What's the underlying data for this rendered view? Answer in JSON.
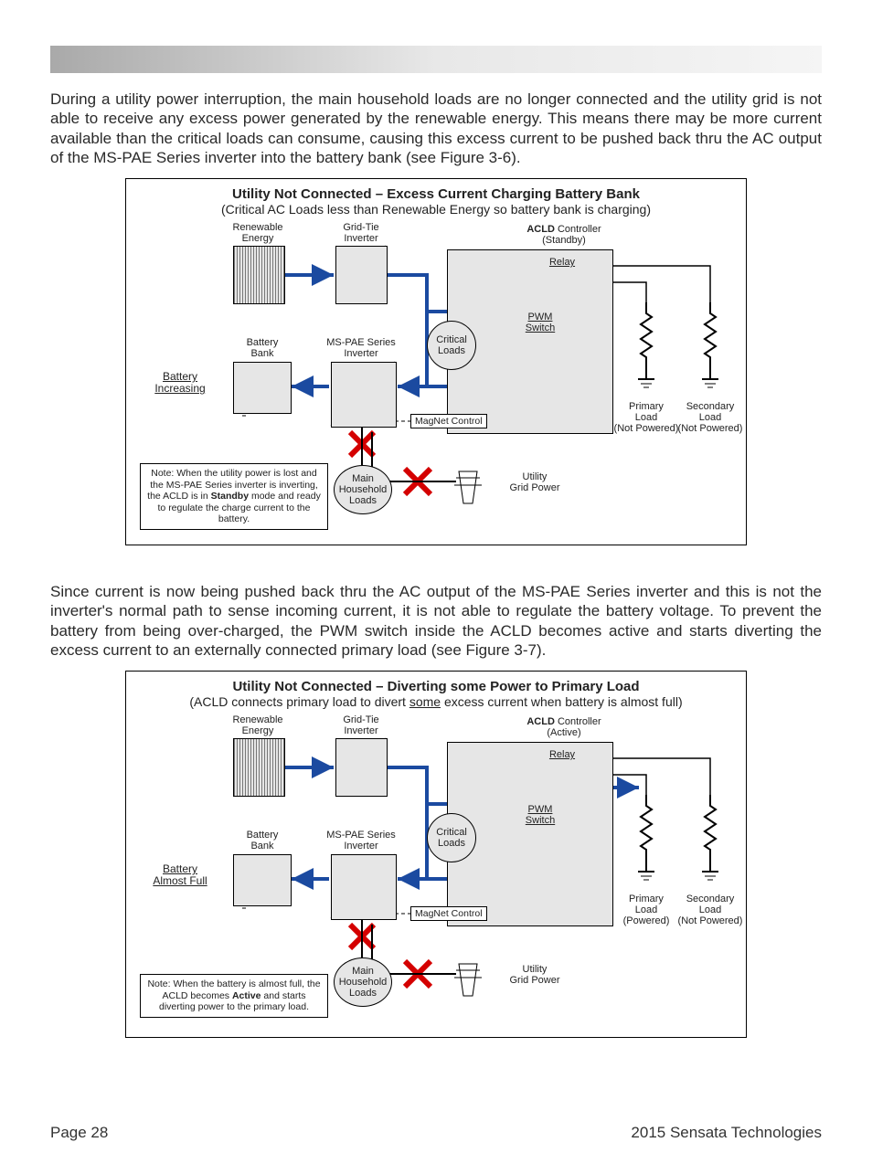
{
  "para1": "During a utility power interruption, the main household loads are no longer connected and the utility grid is not able to receive any excess power generated by the renewable energy. This means there may be more current available than the critical loads can consume, causing this excess current to be pushed back thru the AC output of the MS-PAE Series inverter into the battery bank (see Figure 3-6).",
  "para2": "Since current is now being pushed back thru the AC output of the MS-PAE Series inverter and this is not the inverter's normal path to sense incoming current, it is not able to regulate the battery voltage. To prevent the battery from being over-charged, the PWM switch inside the ACLD becomes active and starts diverting the excess current to an externally connected primary load (see Figure 3-7).",
  "fig1": {
    "title": "Utility Not Connected – Excess Current Charging Battery Bank",
    "subtitle": "(Critical AC Loads less than Renewable Energy so battery bank is charging)",
    "labels": {
      "renewable": "Renewable\nEnergy",
      "gridtie": "Grid-Tie\nInverter",
      "acld_bold": "ACLD",
      "acld_rest": " Controller",
      "acld_mode": "(Standby)",
      "relay": "Relay",
      "pwm": "PWM\nSwitch",
      "critical": "Critical\nLoads",
      "battery_bank": "Battery\nBank",
      "inverter": "MS-PAE Series\nInverter",
      "batt_state": "Battery\nIncreasing",
      "magnet": "MagNet Control",
      "main_loads": "Main\nHousehold\nLoads",
      "utility": "Utility\nGrid Power",
      "primary": "Primary\nLoad\n(Not Powered)",
      "secondary": "Secondary\nLoad\n(Not Powered)"
    },
    "note_pre": "Note: When the utility power is lost and the MS-PAE Series inverter is inverting, the ACLD is in ",
    "note_bold": "Standby",
    "note_post": " mode and ready to regulate the charge current to the battery."
  },
  "fig2": {
    "title": "Utility Not Connected – Diverting some Power to Primary Load",
    "subtitle_pre": "(ACLD connects primary load to divert ",
    "subtitle_u": "some",
    "subtitle_post": " excess current when battery is almost full)",
    "labels": {
      "renewable": "Renewable\nEnergy",
      "gridtie": "Grid-Tie\nInverter",
      "acld_bold": "ACLD",
      "acld_rest": " Controller",
      "acld_mode": "(Active)",
      "relay": "Relay",
      "pwm": "PWM\nSwitch",
      "critical": "Critical\nLoads",
      "battery_bank": "Battery\nBank",
      "inverter": "MS-PAE Series\nInverter",
      "batt_state": "Battery\nAlmost Full",
      "magnet": "MagNet Control",
      "main_loads": "Main\nHousehold\nLoads",
      "utility": "Utility\nGrid Power",
      "primary": "Primary\nLoad\n(Powered)",
      "secondary": "Secondary\nLoad\n(Not Powered)"
    },
    "note_pre": "Note: When the battery is almost full, the ACLD becomes ",
    "note_bold": "Active",
    "note_post": " and starts diverting power to the primary load."
  },
  "footer": {
    "page": "Page 28",
    "copyright": "2015 Sensata Technologies"
  }
}
